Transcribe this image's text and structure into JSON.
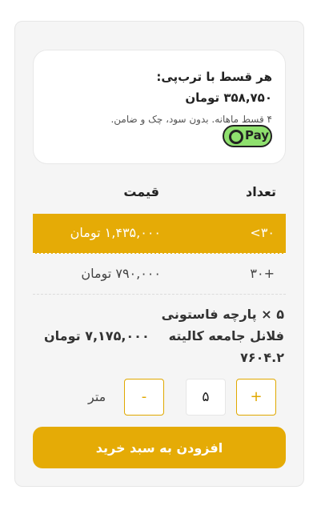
{
  "installment": {
    "title": "هر قسط با ترب‌پی:",
    "amount": "۳۵۸,۷۵۰ تومان",
    "note": "۴ قسط ماهانه. بدون سود، چک و ضامن.",
    "badge_text": "Pay"
  },
  "pricing_table": {
    "header_qty": "تعداد",
    "header_price": "قیمت",
    "rows": [
      {
        "qty": "۳۰>",
        "price": "۱,۴۳۵,۰۰۰ تومان",
        "active": true
      },
      {
        "qty": "+۳۰",
        "price": "۷۹۰,۰۰۰ تومان",
        "active": false
      }
    ]
  },
  "product": {
    "line1": "۵ × پارچه فاستونی",
    "line2_name": "فلانل جامعه کالیته",
    "line2_price": "۷,۱۷۵,۰۰۰ تومان",
    "line3": "۷۶۰۴.۲"
  },
  "quantity": {
    "plus_label": "+",
    "minus_label": "-",
    "value": "۵",
    "unit": "متر"
  },
  "actions": {
    "add_to_cart": "افزودن به سبد خرید"
  },
  "colors": {
    "accent": "#e5ab06",
    "pay_green": "#8fe06e"
  }
}
